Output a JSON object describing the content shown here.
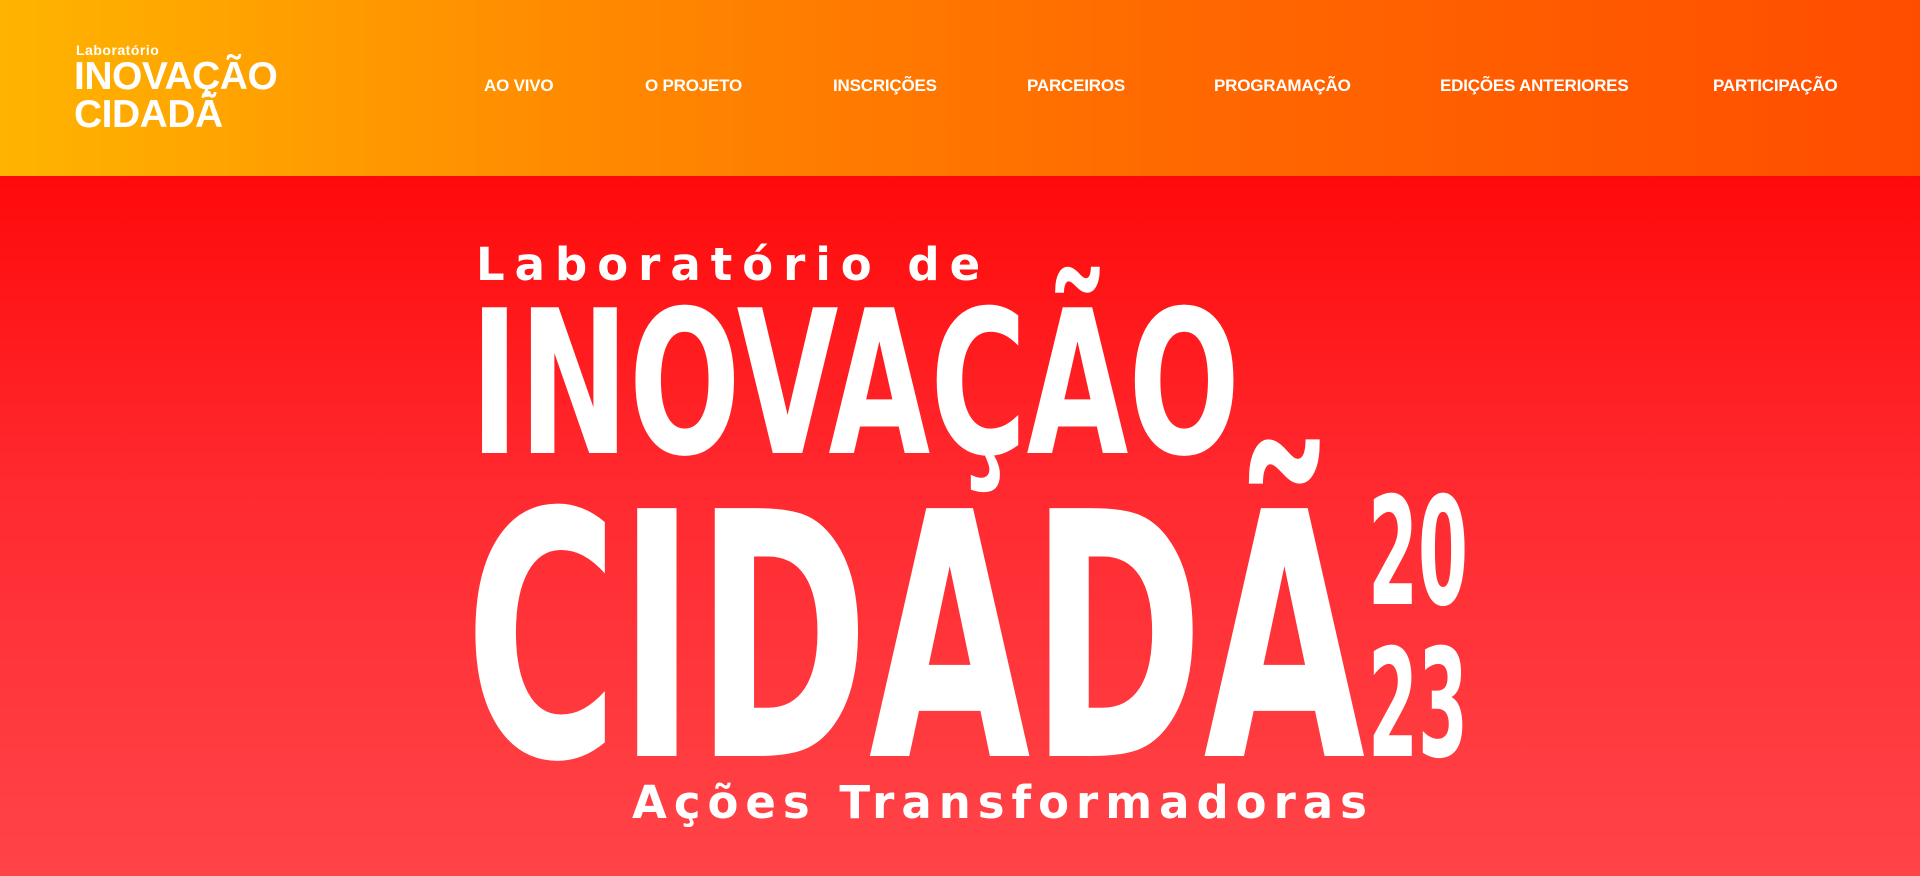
{
  "header": {
    "logo": {
      "small": "Laboratório",
      "line1": "INOVAÇÃO",
      "line2": "CIDADÃ"
    },
    "nav": [
      "AO VIVO",
      "O PROJETO",
      "INSCRIÇÕES",
      "PARCEIROS",
      "PROGRAMAÇÃO",
      "EDIÇÕES ANTERIORES",
      "PARTICIPAÇÃO"
    ]
  },
  "hero": {
    "line1": "Laboratório de",
    "line2": "INOVAÇÃO",
    "line3": "CIDADÃ",
    "year_top": "20",
    "year_bottom": "23",
    "tagline": "Ações Transformadoras"
  },
  "colors": {
    "header_start": "#ffb400",
    "header_end": "#ff4d00",
    "hero_top": "#ff0a0a",
    "hero_bottom": "#ff4448",
    "text": "#ffffff"
  }
}
